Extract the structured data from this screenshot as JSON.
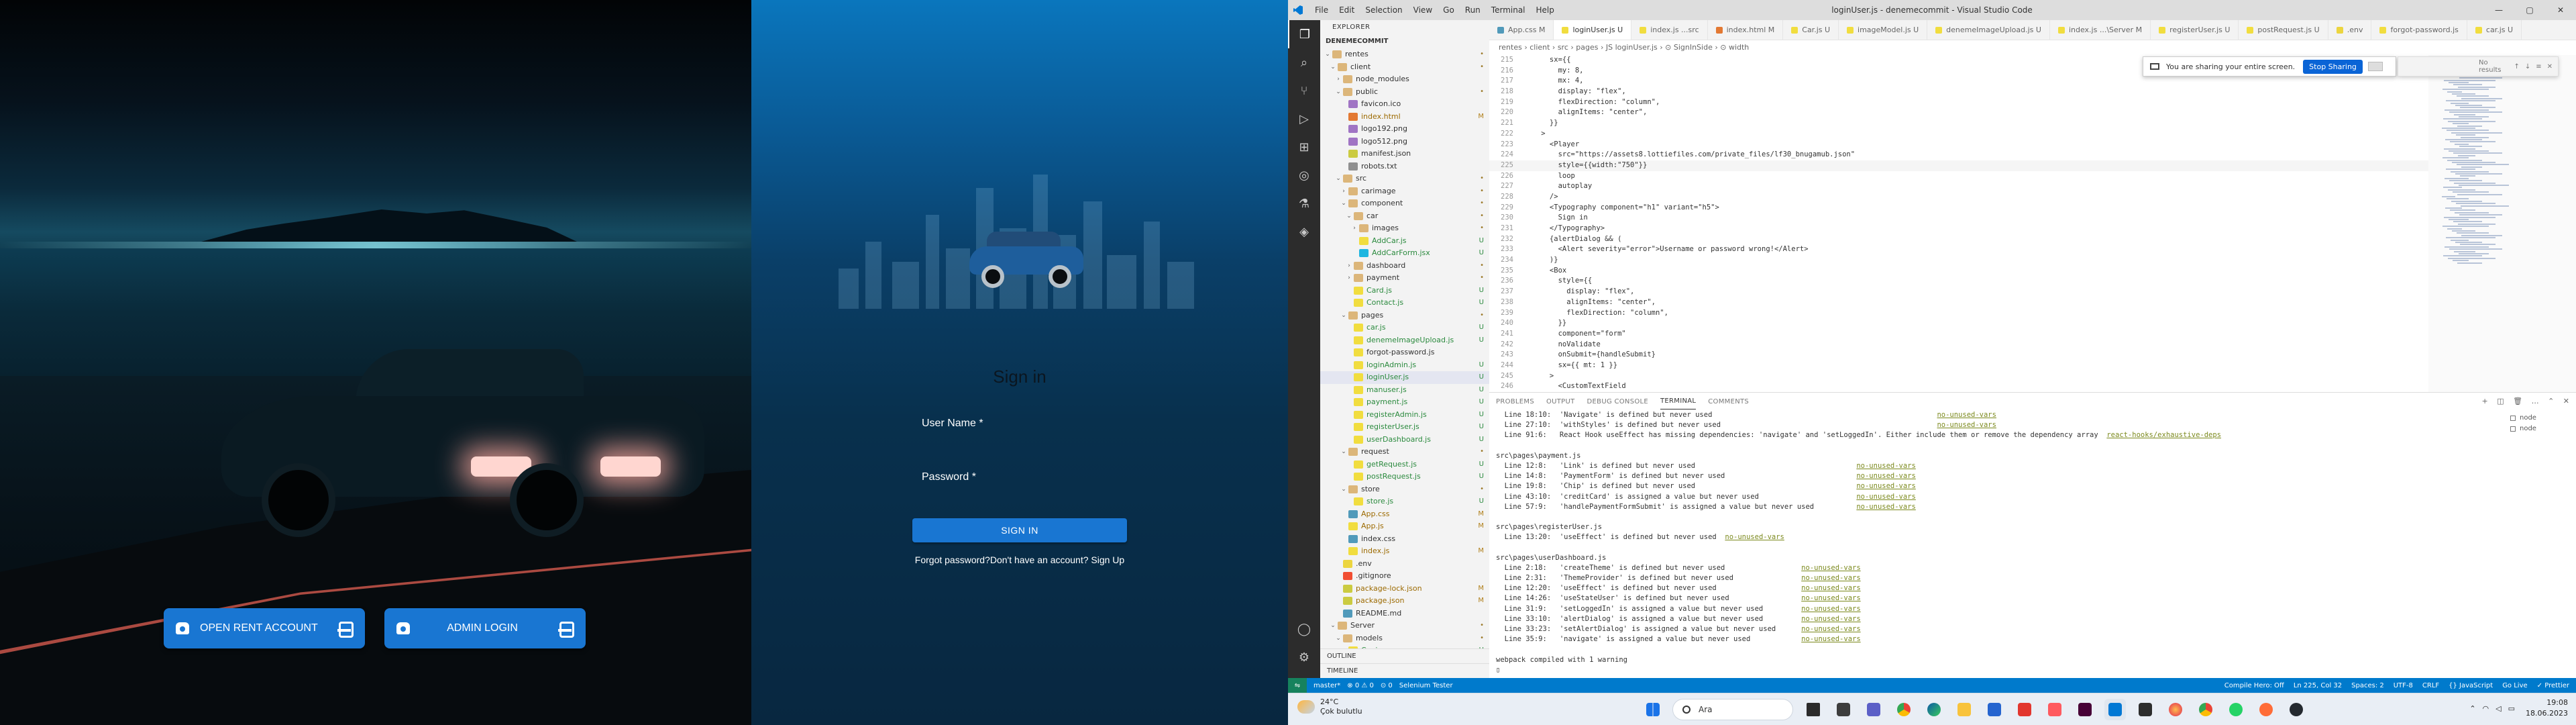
{
  "hero": {
    "open_rent_label": "OPEN RENT ACCOUNT",
    "admin_login_label": "ADMIN LOGIN"
  },
  "signin": {
    "title": "Sign in",
    "username_label": "User Name *",
    "password_label": "Password *",
    "submit_label": "SIGN IN",
    "forgot_text": "Forgot password?",
    "signup_text": "Don't have an account? Sign Up"
  },
  "vscode": {
    "window_title": "loginUser.js - denemecommit - Visual Studio Code",
    "menu": [
      "File",
      "Edit",
      "Selection",
      "View",
      "Go",
      "Run",
      "Terminal",
      "Help"
    ],
    "explorer_title": "EXPLORER",
    "project_name": "DENEMECOMMIT",
    "tree": [
      {
        "name": "rentes",
        "icon": "folder",
        "depth": 0,
        "open": true,
        "badge": "•"
      },
      {
        "name": "client",
        "icon": "folder",
        "depth": 1,
        "open": true,
        "badge": "•"
      },
      {
        "name": "node_modules",
        "icon": "folder",
        "depth": 2,
        "open": false,
        "badge": ""
      },
      {
        "name": "public",
        "icon": "folder",
        "depth": 2,
        "open": true,
        "badge": "•"
      },
      {
        "name": "favicon.ico",
        "icon": "img",
        "depth": 3,
        "badge": ""
      },
      {
        "name": "index.html",
        "icon": "html",
        "depth": 3,
        "badge": "M"
      },
      {
        "name": "logo192.png",
        "icon": "img",
        "depth": 3,
        "badge": ""
      },
      {
        "name": "logo512.png",
        "icon": "img",
        "depth": 3,
        "badge": ""
      },
      {
        "name": "manifest.json",
        "icon": "json",
        "depth": 3,
        "badge": ""
      },
      {
        "name": "robots.txt",
        "icon": "txt",
        "depth": 3,
        "badge": ""
      },
      {
        "name": "src",
        "icon": "folder",
        "depth": 2,
        "open": true,
        "badge": "•"
      },
      {
        "name": "carimage",
        "icon": "folder",
        "depth": 3,
        "open": false,
        "badge": "•"
      },
      {
        "name": "component",
        "icon": "folder",
        "depth": 3,
        "open": true,
        "badge": "•"
      },
      {
        "name": "car",
        "icon": "folder",
        "depth": 4,
        "open": true,
        "badge": "•"
      },
      {
        "name": "images",
        "icon": "folder",
        "depth": 5,
        "open": false,
        "badge": "•"
      },
      {
        "name": "AddCar.js",
        "icon": "js",
        "depth": 5,
        "badge": "U"
      },
      {
        "name": "AddCarForm.jsx",
        "icon": "react",
        "depth": 5,
        "badge": "U"
      },
      {
        "name": "dashboard",
        "icon": "folder",
        "depth": 4,
        "open": false,
        "badge": "•"
      },
      {
        "name": "payment",
        "icon": "folder",
        "depth": 4,
        "open": false,
        "badge": "•"
      },
      {
        "name": "Card.js",
        "icon": "js",
        "depth": 4,
        "badge": "U"
      },
      {
        "name": "Contact.js",
        "icon": "js",
        "depth": 4,
        "badge": "U"
      },
      {
        "name": "pages",
        "icon": "folder",
        "depth": 3,
        "open": true,
        "badge": "•"
      },
      {
        "name": "car.js",
        "icon": "js",
        "depth": 4,
        "badge": "U"
      },
      {
        "name": "denemeImageUpload.js",
        "icon": "js",
        "depth": 4,
        "badge": "U"
      },
      {
        "name": "forgot-password.js",
        "icon": "js",
        "depth": 4,
        "badge": ""
      },
      {
        "name": "loginAdmin.js",
        "icon": "js",
        "depth": 4,
        "badge": "U"
      },
      {
        "name": "loginUser.js",
        "icon": "js",
        "depth": 4,
        "badge": "U",
        "selected": true
      },
      {
        "name": "manuser.js",
        "icon": "js",
        "depth": 4,
        "badge": "U"
      },
      {
        "name": "payment.js",
        "icon": "js",
        "depth": 4,
        "badge": "U"
      },
      {
        "name": "registerAdmin.js",
        "icon": "js",
        "depth": 4,
        "badge": "U"
      },
      {
        "name": "registerUser.js",
        "icon": "js",
        "depth": 4,
        "badge": "U"
      },
      {
        "name": "userDashboard.js",
        "icon": "js",
        "depth": 4,
        "badge": "U"
      },
      {
        "name": "request",
        "icon": "folder",
        "depth": 3,
        "open": true,
        "badge": "•"
      },
      {
        "name": "getRequest.js",
        "icon": "js",
        "depth": 4,
        "badge": "U"
      },
      {
        "name": "postRequest.js",
        "icon": "js",
        "depth": 4,
        "badge": "U"
      },
      {
        "name": "store",
        "icon": "folder",
        "depth": 3,
        "open": true,
        "badge": "•"
      },
      {
        "name": "store.js",
        "icon": "js",
        "depth": 4,
        "badge": "U"
      },
      {
        "name": "App.css",
        "icon": "css",
        "depth": 3,
        "badge": "M"
      },
      {
        "name": "App.js",
        "icon": "js",
        "depth": 3,
        "badge": "M"
      },
      {
        "name": "index.css",
        "icon": "css",
        "depth": 3,
        "badge": ""
      },
      {
        "name": "index.js",
        "icon": "js",
        "depth": 3,
        "badge": "M"
      },
      {
        "name": ".env",
        "icon": "env",
        "depth": 2,
        "badge": ""
      },
      {
        "name": ".gitignore",
        "icon": "git",
        "depth": 2,
        "badge": ""
      },
      {
        "name": "package-lock.json",
        "icon": "json",
        "depth": 2,
        "badge": "M"
      },
      {
        "name": "package.json",
        "icon": "json",
        "depth": 2,
        "badge": "M"
      },
      {
        "name": "README.md",
        "icon": "md",
        "depth": 2,
        "badge": ""
      },
      {
        "name": "Server",
        "icon": "folder",
        "depth": 1,
        "open": true,
        "badge": "•"
      },
      {
        "name": "models",
        "icon": "folder",
        "depth": 2,
        "open": true,
        "badge": "•"
      },
      {
        "name": "Car.js",
        "icon": "js",
        "depth": 3,
        "badge": "U"
      }
    ],
    "outline_label": "OUTLINE",
    "timeline_label": "TIMELINE",
    "tabs": [
      {
        "label": "App.css M",
        "icon": "css",
        "active": false
      },
      {
        "label": "loginUser.js U",
        "icon": "js",
        "active": true
      },
      {
        "label": "index.js ...src",
        "icon": "js",
        "active": false
      },
      {
        "label": "index.html M",
        "icon": "html",
        "active": false
      },
      {
        "label": "Car.js U",
        "icon": "js",
        "active": false
      },
      {
        "label": "imageModel.js U",
        "icon": "js",
        "active": false
      },
      {
        "label": "denemeImageUpload.js U",
        "icon": "js",
        "active": false
      },
      {
        "label": "index.js ...\\Server M",
        "icon": "js",
        "active": false
      },
      {
        "label": "registerUser.js U",
        "icon": "js",
        "active": false
      },
      {
        "label": "postRequest.js U",
        "icon": "js",
        "active": false
      },
      {
        "label": ".env",
        "icon": "env",
        "active": false
      },
      {
        "label": "forgot-password.js",
        "icon": "js",
        "active": false
      },
      {
        "label": "car.js U",
        "icon": "js",
        "active": false
      }
    ],
    "breadcrumb": "rentes › client › src › pages › JS loginUser.js › ⊙ SignInSide › ⊙ width",
    "code_lines": [
      {
        "n": "215",
        "t": "      sx={{"
      },
      {
        "n": "216",
        "t": "        my: 8,"
      },
      {
        "n": "217",
        "t": "        mx: 4,"
      },
      {
        "n": "218",
        "t": "        display: \"flex\","
      },
      {
        "n": "219",
        "t": "        flexDirection: \"column\","
      },
      {
        "n": "220",
        "t": "        alignItems: \"center\","
      },
      {
        "n": "221",
        "t": "      }}"
      },
      {
        "n": "222",
        "t": "    >"
      },
      {
        "n": "223",
        "t": "      <Player"
      },
      {
        "n": "224",
        "t": "        src=\"https://assets8.lottiefiles.com/private_files/lf30_bnugamub.json\""
      },
      {
        "n": "225",
        "t": "        style={{width:\"750\"}}"
      },
      {
        "n": "226",
        "t": "        loop"
      },
      {
        "n": "227",
        "t": "        autoplay"
      },
      {
        "n": "228",
        "t": "      />"
      },
      {
        "n": "229",
        "t": "      <Typography component=\"h1\" variant=\"h5\">"
      },
      {
        "n": "230",
        "t": "        Sign in"
      },
      {
        "n": "231",
        "t": "      </Typography>"
      },
      {
        "n": "232",
        "t": "      {alertDialog && ("
      },
      {
        "n": "233",
        "t": "        <Alert severity=\"error\">Username or password wrong!</Alert>"
      },
      {
        "n": "234",
        "t": "      )}"
      },
      {
        "n": "235",
        "t": "      <Box"
      },
      {
        "n": "236",
        "t": "        style={{"
      },
      {
        "n": "237",
        "t": "          display: \"flex\","
      },
      {
        "n": "238",
        "t": "          alignItems: \"center\","
      },
      {
        "n": "239",
        "t": "          flexDirection: \"column\","
      },
      {
        "n": "240",
        "t": "        }}"
      },
      {
        "n": "241",
        "t": "        component=\"form\""
      },
      {
        "n": "242",
        "t": "        noValidate"
      },
      {
        "n": "243",
        "t": "        onSubmit={handleSubmit}"
      },
      {
        "n": "244",
        "t": "        sx={{ mt: 1 }}"
      },
      {
        "n": "245",
        "t": "      >"
      },
      {
        "n": "246",
        "t": "        <CustomTextField"
      }
    ],
    "share_text": "You are sharing your entire screen.",
    "stop_sharing": "Stop Sharing",
    "find_text": "No results",
    "panel_tabs": [
      "PROBLEMS",
      "OUTPUT",
      "DEBUG CONSOLE",
      "TERMINAL",
      "COMMENTS"
    ],
    "terminal_lines": [
      {
        "t": "  Line 18:10:  'Navigate' is defined but never used                                                     ",
        "r": "no-unused-vars"
      },
      {
        "t": "  Line 27:10:  'withStyles' is defined but never used                                                   ",
        "r": "no-unused-vars"
      },
      {
        "t": "  Line 91:6:   React Hook useEffect has missing dependencies: 'navigate' and 'setLoggedIn'. Either include them or remove the dependency array  ",
        "r": "react-hooks/exhaustive-deps"
      },
      {
        "t": "",
        "r": ""
      },
      {
        "t": "src\\pages\\payment.js",
        "r": ""
      },
      {
        "t": "  Line 12:8:   'Link' is defined but never used                                      ",
        "r": "no-unused-vars"
      },
      {
        "t": "  Line 14:8:   'PaymentForm' is defined but never used                               ",
        "r": "no-unused-vars"
      },
      {
        "t": "  Line 19:8:   'Chip' is defined but never used                                      ",
        "r": "no-unused-vars"
      },
      {
        "t": "  Line 43:10:  'creditCard' is assigned a value but never used                       ",
        "r": "no-unused-vars"
      },
      {
        "t": "  Line 57:9:   'handlePaymentFormSubmit' is assigned a value but never used          ",
        "r": "no-unused-vars"
      },
      {
        "t": "",
        "r": ""
      },
      {
        "t": "src\\pages\\registerUser.js",
        "r": ""
      },
      {
        "t": "  Line 13:20:  'useEffect' is defined but never used  ",
        "r": "no-unused-vars"
      },
      {
        "t": "",
        "r": ""
      },
      {
        "t": "src\\pages\\userDashboard.js",
        "r": ""
      },
      {
        "t": "  Line 2:18:   'createTheme' is defined but never used                  ",
        "r": "no-unused-vars"
      },
      {
        "t": "  Line 2:31:   'ThemeProvider' is defined but never used                ",
        "r": "no-unused-vars"
      },
      {
        "t": "  Line 12:20:  'useEffect' is defined but never used                    ",
        "r": "no-unused-vars"
      },
      {
        "t": "  Line 14:26:  'useStateUser' is defined but never used                 ",
        "r": "no-unused-vars"
      },
      {
        "t": "  Line 31:9:   'setLoggedIn' is assigned a value but never used         ",
        "r": "no-unused-vars"
      },
      {
        "t": "  Line 33:10:  'alertDialog' is assigned a value but never used         ",
        "r": "no-unused-vars"
      },
      {
        "t": "  Line 33:23:  'setAlertDialog' is assigned a value but never used      ",
        "r": "no-unused-vars"
      },
      {
        "t": "  Line 35:9:   'navigate' is assigned a value but never used            ",
        "r": "no-unused-vars"
      },
      {
        "t": "",
        "r": ""
      },
      {
        "t": "webpack compiled with 1 warning",
        "r": ""
      },
      {
        "t": "▯",
        "r": ""
      }
    ],
    "terminal_instances": [
      "node",
      "node"
    ],
    "status_left": [
      "master*",
      "⊗ 0 ⚠ 0",
      "⊙ 0",
      "Selenium Tester"
    ],
    "status_right": [
      "Compile Hero: Off",
      "Ln 225, Col 32",
      "Spaces: 2",
      "UTF-8",
      "CRLF",
      "{} JavaScript",
      "Go Live",
      "✓ Prettier"
    ]
  },
  "taskbar": {
    "temp": "24°C",
    "weather": "Çok bulutlu",
    "search_placeholder": "Ara",
    "time": "19:08",
    "date": "18.06.2023"
  }
}
